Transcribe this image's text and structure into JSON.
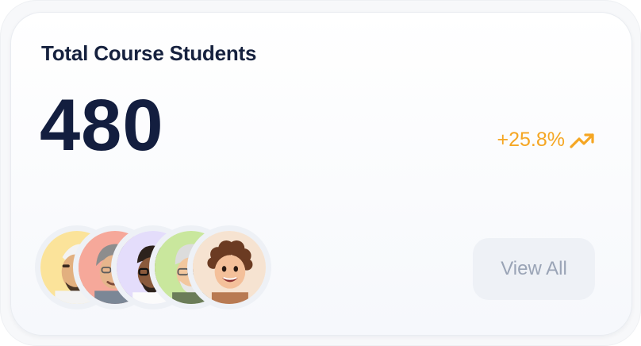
{
  "card": {
    "title": "Total Course Students",
    "count": "480",
    "growth": {
      "text": "+25.8%",
      "icon": "trending-up-icon",
      "color": "#f5a623"
    },
    "avatars": [
      {
        "name": "avatar-1",
        "bg": "#fbe39a"
      },
      {
        "name": "avatar-2",
        "bg": "#f6a89a"
      },
      {
        "name": "avatar-3",
        "bg": "#e4ddfb"
      },
      {
        "name": "avatar-4",
        "bg": "#c9e79d"
      },
      {
        "name": "avatar-5",
        "bg": "#f6e3d1"
      }
    ],
    "view_all_label": "View All"
  }
}
